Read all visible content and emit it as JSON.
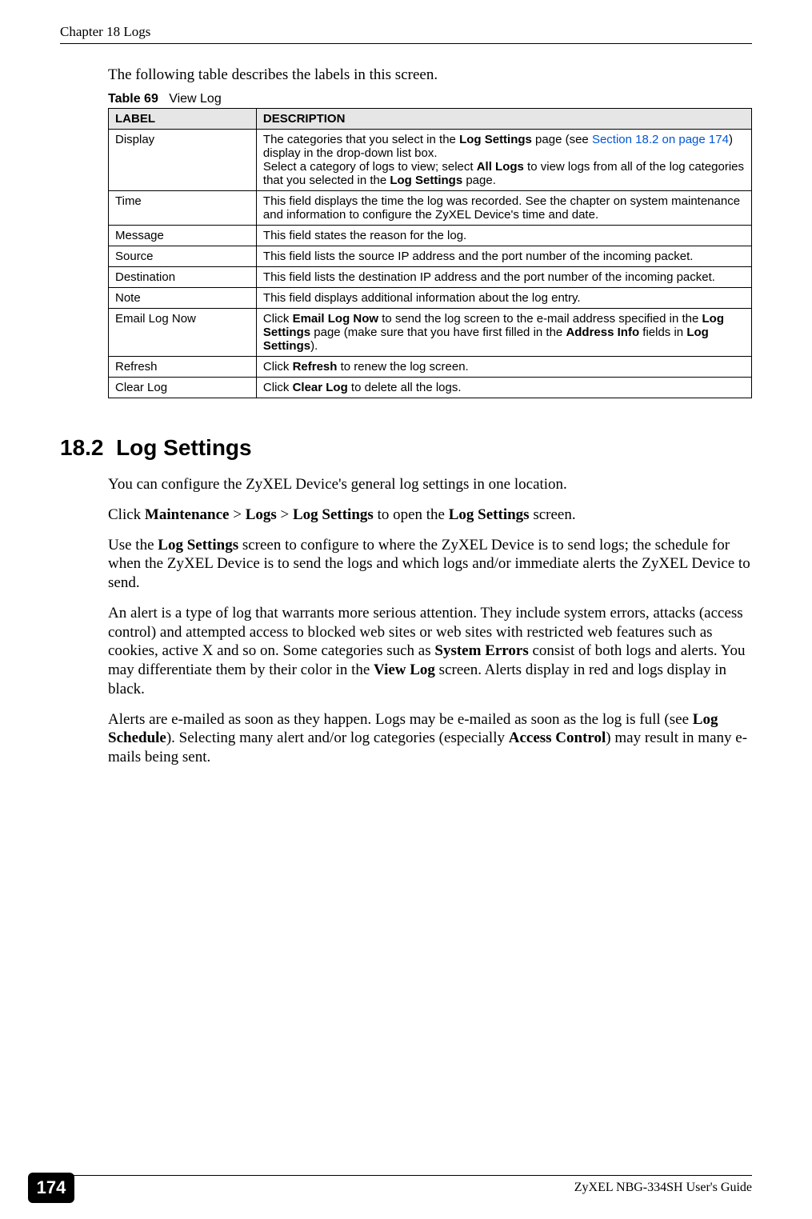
{
  "header": {
    "chapter": "Chapter 18 Logs"
  },
  "intro": "The following table describes the labels in this screen.",
  "table_caption_prefix": "Table 69",
  "table_caption_title": "View Log",
  "table": {
    "headers": {
      "label": "LABEL",
      "description": "DESCRIPTION"
    },
    "rows": [
      {
        "label": "Display",
        "desc_pre": "The categories that you select in the ",
        "desc_bold1": "Log Settings",
        "desc_mid1": " page (see ",
        "desc_link": "Section 18.2 on page 174",
        "desc_mid2": ") display in the drop-down list box.",
        "desc_line2_pre": "Select a category of logs to view; select ",
        "desc_line2_b1": "All Logs",
        "desc_line2_mid": " to view logs from all of the log categories that you selected in the ",
        "desc_line2_b2": "Log Settings",
        "desc_line2_post": " page."
      },
      {
        "label": "Time",
        "desc": "This field displays the time the log was recorded. See the chapter on system maintenance and information to configure the ZyXEL Device's time and date."
      },
      {
        "label": "Message",
        "desc": "This field states the reason for the log."
      },
      {
        "label": "Source",
        "desc": "This field lists the source IP address and the port number of the incoming packet."
      },
      {
        "label": "Destination",
        "desc": "This field lists the destination IP address and the port number of the incoming packet."
      },
      {
        "label": "Note",
        "desc": "This field displays additional information about the log entry."
      },
      {
        "label": "Email Log Now",
        "pre": "Click ",
        "b1": "Email Log Now",
        "mid1": " to send the log screen to the e-mail address specified in the ",
        "b2": "Log Settings",
        "mid2": " page (make sure that you have first filled in the ",
        "b3": "Address Info",
        "mid3": " fields in ",
        "b4": "Log Settings",
        "post": ")."
      },
      {
        "label": "Refresh",
        "pre": "Click ",
        "b1": "Refresh",
        "post": " to renew the log screen."
      },
      {
        "label": "Clear Log",
        "pre": "Click ",
        "b1": "Clear Log",
        "post": " to delete all the logs."
      }
    ]
  },
  "section": {
    "number": "18.2",
    "title": "Log Settings"
  },
  "paragraphs": {
    "p1": "You can configure the ZyXEL Device's general log settings in one location.",
    "p2_pre": "Click ",
    "p2_b1": "Maintenance",
    "p2_sep1": " > ",
    "p2_b2": "Logs",
    "p2_sep2": " > ",
    "p2_b3": "Log Settings",
    "p2_mid": " to open the ",
    "p2_b4": "Log Settings",
    "p2_post": " screen.",
    "p3_pre": "Use the ",
    "p3_b1": "Log Settings",
    "p3_post": " screen to configure to where the ZyXEL Device is to send logs; the schedule for when the ZyXEL Device is to send the logs and which logs and/or immediate alerts the ZyXEL Device to send.",
    "p4_pre": "An alert is a type of log that warrants more serious attention. They include system errors, attacks (access control) and attempted access to blocked web sites or web sites with restricted web features such as cookies, active X and so on. Some categories such as ",
    "p4_b1": "System Errors",
    "p4_mid1": " consist of both logs and alerts. You may differentiate them by their color in the ",
    "p4_b2": "View Log",
    "p4_post": " screen. Alerts display in red and logs display in black.",
    "p5_pre": "Alerts are e-mailed as soon as they happen. Logs may be e-mailed as soon as the log is full (see ",
    "p5_b1": "Log Schedule",
    "p5_mid": "). Selecting many alert and/or log categories (especially ",
    "p5_b2": "Access Control",
    "p5_post": ") may result in many e-mails being sent."
  },
  "footer": {
    "page": "174",
    "guide": "ZyXEL NBG-334SH User's Guide"
  }
}
